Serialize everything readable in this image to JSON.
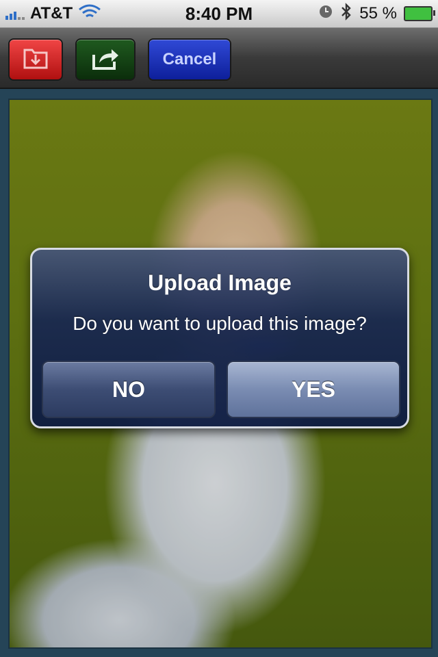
{
  "status_bar": {
    "carrier": "AT&T",
    "time": "8:40 PM",
    "battery": "55 %"
  },
  "toolbar": {
    "save_icon": "save-to-folder-icon",
    "share_icon": "share-arrow-icon",
    "cancel_label": "Cancel"
  },
  "alert": {
    "title": "Upload Image",
    "message": "Do you want to upload this image?",
    "no_label": "NO",
    "yes_label": "YES"
  }
}
